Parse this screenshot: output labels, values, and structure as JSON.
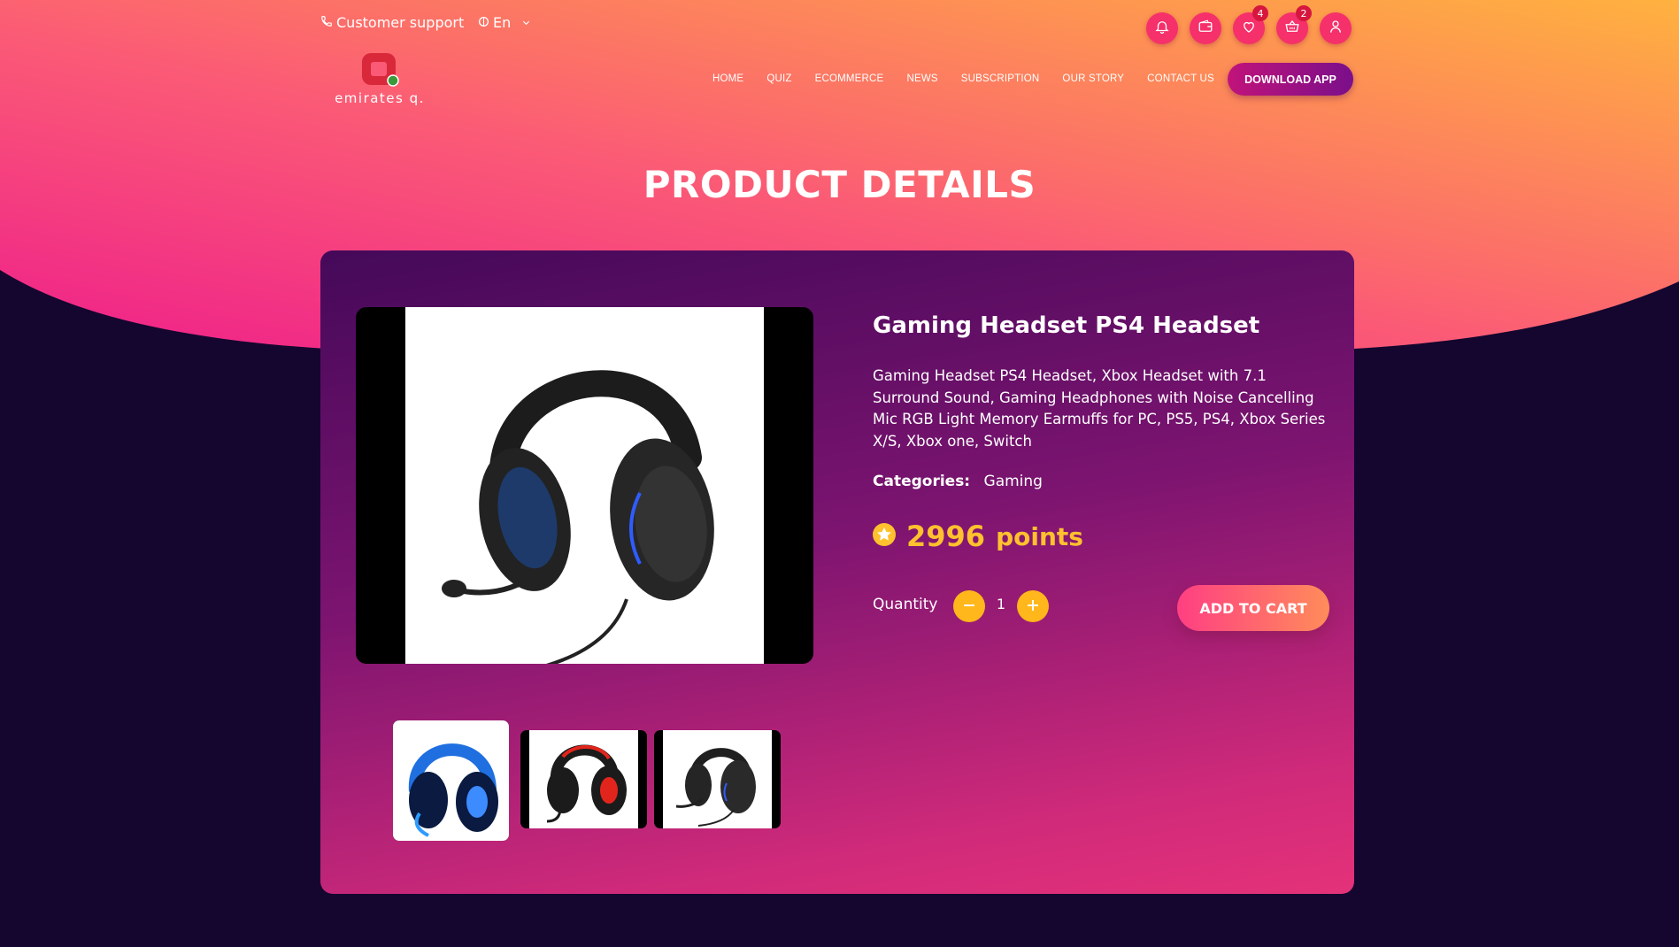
{
  "topbar": {
    "support_label": "Customer support",
    "language": "En",
    "wishlist_count": "4",
    "cart_count": "2"
  },
  "logo": {
    "text": "emirates q."
  },
  "nav": {
    "items": [
      "HOME",
      "QUIZ",
      "ECOMMERCE",
      "NEWS",
      "SUBSCRIPTION",
      "OUR STORY",
      "CONTACT US"
    ],
    "download_label": "DOWNLOAD APP"
  },
  "page": {
    "title": "PRODUCT DETAILS"
  },
  "product": {
    "title": "Gaming Headset PS4 Headset",
    "description": "Gaming Headset PS4 Headset, Xbox Headset with 7.1 Surround Sound, Gaming Headphones with Noise Cancelling Mic RGB Light Memory Earmuffs for PC, PS5, PS4, Xbox Series X/S, Xbox one, Switch",
    "categories_label": "Categories:",
    "category": "Gaming",
    "price_value": "2996",
    "price_unit": "points",
    "quantity_label": "Quantity",
    "quantity": "1",
    "add_to_cart_label": "ADD TO CART"
  },
  "colors": {
    "accent_gold": "#ffc12e",
    "pink": "#f5306a",
    "dark_bg": "#14062e"
  },
  "icons": [
    "phone-icon",
    "globe-icon",
    "chevron-down-icon",
    "bell-icon",
    "wallet-icon",
    "heart-icon",
    "basket-icon",
    "user-icon",
    "star-icon",
    "minus-icon",
    "plus-icon"
  ]
}
